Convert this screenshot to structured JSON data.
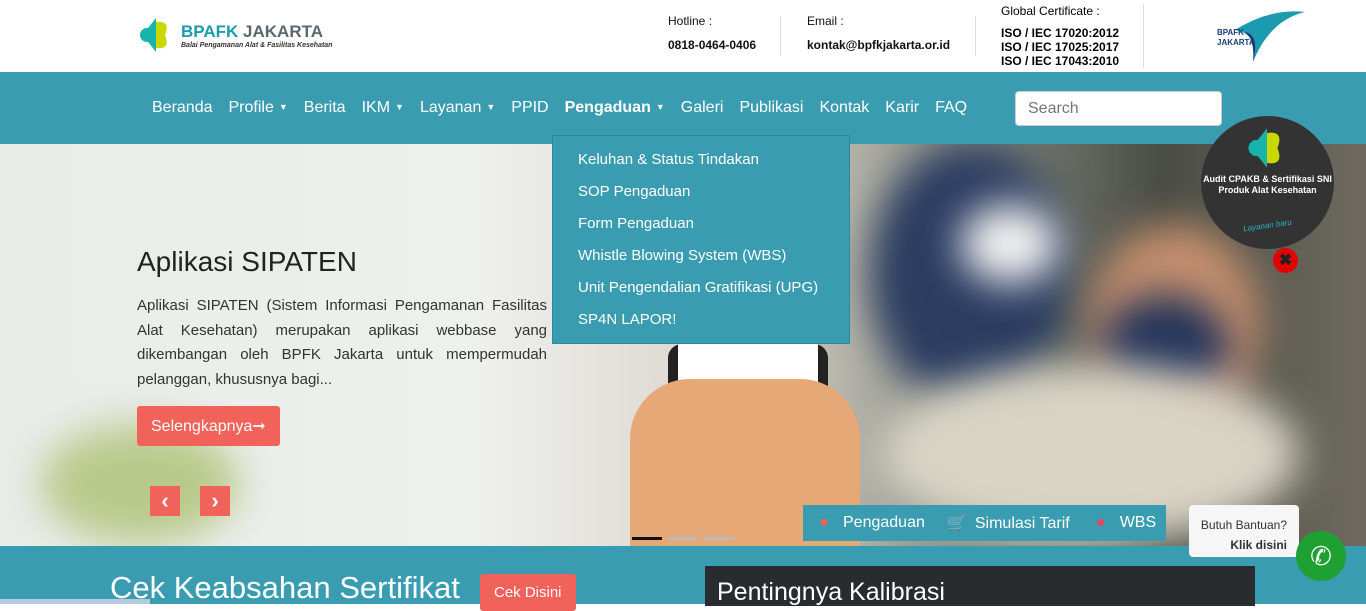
{
  "header": {
    "logo_title": "BPAFK",
    "logo_title2": "JAKARTA",
    "logo_subtitle": "Balai Pengamanan Alat & Fasilitas Kesehatan",
    "hotline_label": "Hotline :",
    "hotline": "0818-0464-0406",
    "email_label": "Email :",
    "email": "kontak@bpfkjakarta.or.id",
    "cert_label": "Global Certificate :",
    "certs": [
      "ISO / IEC 17020:2012",
      "ISO / IEC 17025:2017",
      "ISO / IEC 17043:2010"
    ],
    "right_logo": "BPAFK JAKARTA"
  },
  "nav": {
    "items": [
      "Beranda",
      "Profile",
      "Berita",
      "IKM",
      "Layanan",
      "PPID",
      "Pengaduan",
      "Galeri",
      "Publikasi",
      "Kontak",
      "Karir",
      "FAQ"
    ],
    "search_placeholder": "Search"
  },
  "dropdown": [
    "Keluhan & Status Tindakan",
    "SOP Pengaduan",
    "Form Pengaduan",
    "Whistle Blowing System (WBS)",
    "Unit Pengendalian Gratifikasi (UPG)",
    "SP4N LAPOR!"
  ],
  "hero": {
    "title": "Aplikasi SIPATEN",
    "text": "Aplikasi SIPATEN (Sistem Informasi Pengamanan Fasilitas Alat Kesehatan) merupakan aplikasi webbase yang dikembangan oleh BPFK Jakarta untuk mempermudah pelanggan, khususnya bagi...",
    "button": "Selengkapnya➞",
    "prev": "‹",
    "next": "›"
  },
  "quick": [
    "Pengaduan",
    "Simulasi Tarif",
    "WBS"
  ],
  "help": {
    "line1": "Butuh Bantuan?",
    "line2": "Klik disini"
  },
  "badge": {
    "title": "Audit CPAKB & Sertifikasi SNI Produk Alat Kesehatan",
    "sub": "Layanan baru"
  },
  "bottom": {
    "title": "Cek Keabsahan Sertifikat",
    "button": "Cek Disini",
    "card_title": "Pentingnya Kalibrasi"
  }
}
